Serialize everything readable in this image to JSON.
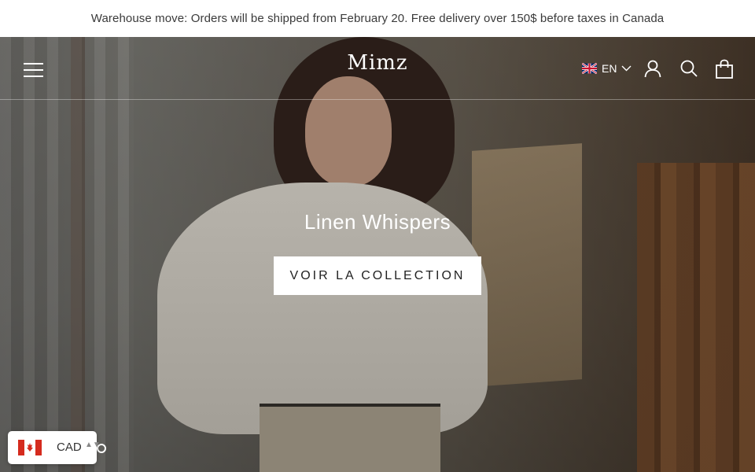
{
  "announcement": "Warehouse move: Orders will be shipped from February 20. Free delivery over 150$ before taxes in Canada",
  "header": {
    "logo": "Mimz",
    "language": "EN",
    "icons": [
      "menu-icon",
      "account-icon",
      "search-icon",
      "cart-icon"
    ]
  },
  "hero": {
    "title": "Linen Whispers",
    "cta": "VOIR LA COLLECTION"
  },
  "currency_selector": {
    "code": "CAD",
    "caret": "▲▼"
  },
  "colors": {
    "overlay_text": "#ffffff",
    "cta_bg": "#ffffff",
    "cta_text": "#222222",
    "canada_red": "#d52b1e"
  }
}
